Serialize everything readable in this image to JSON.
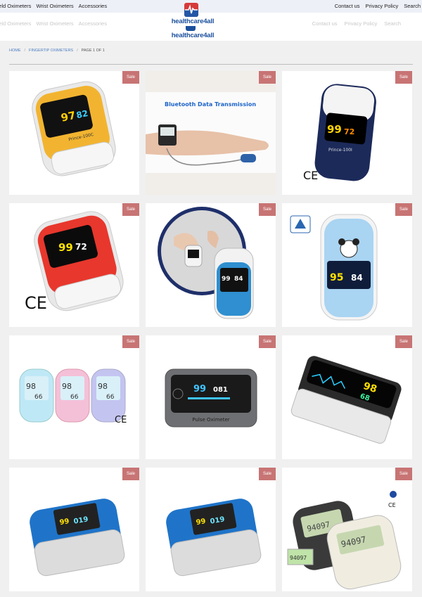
{
  "header": {
    "nav_left": [
      "held Oximeters",
      "Wrist Oximeters",
      "Accessories"
    ],
    "nav_right": [
      "Contact us",
      "Privacy Policy",
      "Search"
    ],
    "ghost_left": [
      "held Oximeters",
      "Wrist Oximeters",
      "Accessories"
    ],
    "ghost_right": [
      "Contact us",
      "Privacy Policy",
      "Search"
    ],
    "logo_text": "healthcare4all",
    "logo_text_2": "healthcare4all"
  },
  "breadcrumb": {
    "home": "HOME",
    "category": "FINGERTIP OXIMETERS",
    "current": "PAGE 1 OF 1",
    "separator": "/"
  },
  "products": [
    {
      "badge": "Sale",
      "image": "heal-force-yellow-oximeter",
      "screen": [
        "97",
        "82"
      ],
      "caption": "Prince-100C",
      "mark": ""
    },
    {
      "badge": "Sale",
      "image": "bluetooth-wrist-oximeter",
      "banner": "Bluetooth Data Transmission"
    },
    {
      "badge": "Sale",
      "image": "heal-force-navy-oximeter",
      "screen": [
        "99",
        "72"
      ],
      "caption": "Prince-100I",
      "mark": "CE"
    },
    {
      "badge": "Sale",
      "image": "heal-force-red-oximeter",
      "screen": [
        "99",
        "72"
      ],
      "mark": "CE"
    },
    {
      "badge": "Sale",
      "image": "prince-100b-oximeter",
      "screen": [
        "99",
        "84"
      ]
    },
    {
      "badge": "Sale",
      "image": "panda-kids-oximeter",
      "screen": [
        "95",
        "84"
      ]
    },
    {
      "badge": "Sale",
      "image": "pastel-trio-oximeters",
      "screen": [
        "98",
        "66"
      ],
      "mark": "CE"
    },
    {
      "badge": "Sale",
      "image": "gray-pulse-oximeter",
      "screen": [
        "99",
        "081"
      ],
      "caption": "Pulse Oximeter"
    },
    {
      "badge": "Sale",
      "image": "black-oled-oximeter",
      "screen": [
        "98",
        "68"
      ]
    },
    {
      "badge": "Sale",
      "image": "blue-fingertip-oximeter",
      "screen": [
        "99",
        "019"
      ]
    },
    {
      "badge": "Sale",
      "image": "blue-fingertip-oximeter-2",
      "screen": [
        "99",
        "019"
      ]
    },
    {
      "badge": "Sale",
      "image": "lcd-oximeters-pair",
      "screen": [
        "94097",
        "94097"
      ],
      "mark": "CE"
    }
  ],
  "colors": {
    "sale_badge": "#c87474",
    "brand_blue": "#1b4f9c",
    "brand_red": "#d63a3a",
    "link": "#4a7bc0"
  }
}
